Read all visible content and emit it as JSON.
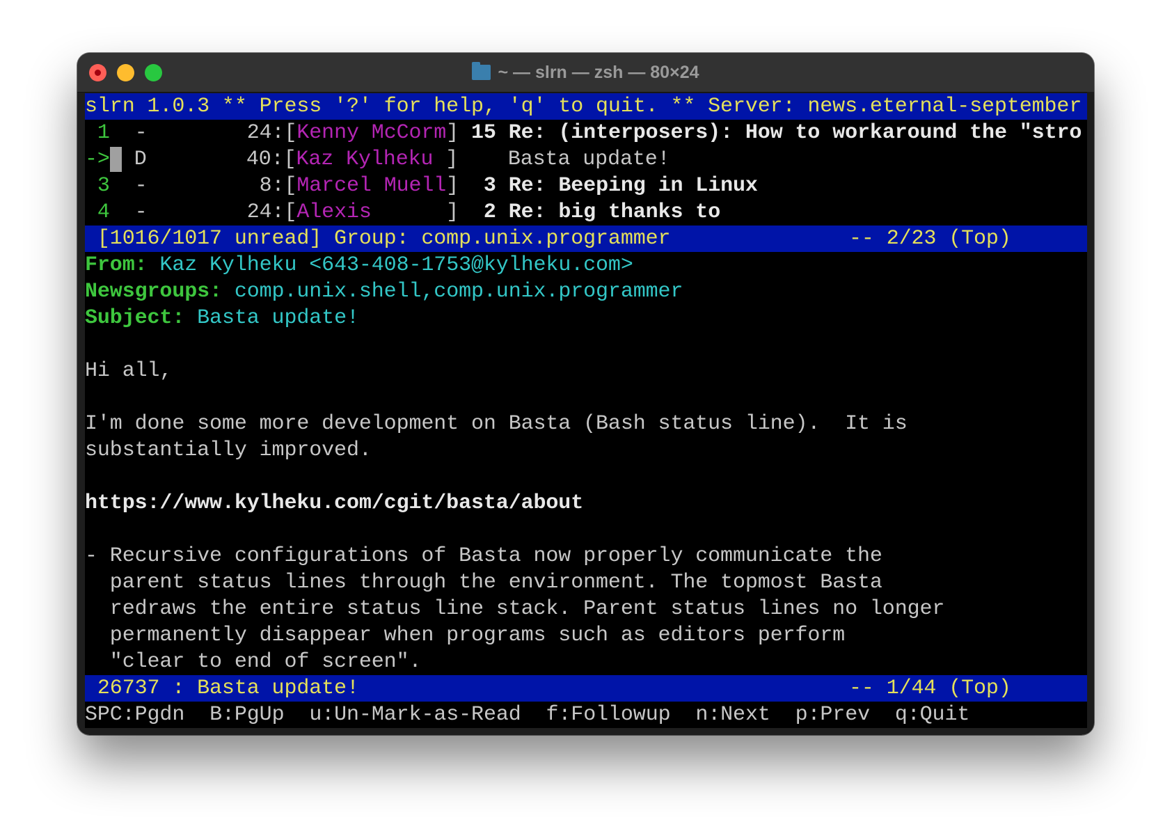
{
  "window": {
    "title": "~ — slrn — zsh — 80×24",
    "folder_icon": "folder-icon"
  },
  "top_status": "slrn 1.0.3 ** Press '?' for help, 'q' to quit. ** Server: news.eternal-september",
  "header_rows": [
    {
      "num": " 1",
      "pointer": "",
      "flag": "-",
      "lines": "        24:",
      "author": "Kenny McCorm",
      "thread_count": "15",
      "subject": "Re: (interposers): How to workaround the \"stro",
      "unread": true
    },
    {
      "num": "",
      "pointer": "->",
      "flag": "D",
      "lines": "        40:",
      "author": "Kaz Kylheku ",
      "thread_count": "  ",
      "subject": "Basta update!",
      "unread": false
    },
    {
      "num": " 3",
      "pointer": "",
      "flag": "-",
      "lines": "         8:",
      "author": "Marcel Muell",
      "thread_count": " 3",
      "subject": "Re: Beeping in Linux",
      "unread": true
    },
    {
      "num": " 4",
      "pointer": "",
      "flag": "-",
      "lines": "        24:",
      "author": "Alexis      ",
      "thread_count": " 2",
      "subject": "Re: big thanks to",
      "unread": true
    }
  ],
  "group_status": {
    "left": " [1016/1017 unread] Group: comp.unix.programmer",
    "right": "-- 2/23 (Top)"
  },
  "article_headers": [
    {
      "label": "From:",
      "value": "Kaz Kylheku <643-408-1753@kylheku.com>"
    },
    {
      "label": "Newsgroups:",
      "value": "comp.unix.shell,comp.unix.programmer"
    },
    {
      "label": "Subject:",
      "value": "Basta update!"
    }
  ],
  "body": {
    "greeting": "Hi all,",
    "para1": [
      "I'm done some more development on Basta (Bash status line).  It is",
      "substantially improved."
    ],
    "url": "https://www.kylheku.com/cgit/basta/about",
    "bullet": [
      "- Recursive configurations of Basta now properly communicate the",
      "  parent status lines through the environment. The topmost Basta",
      "  redraws the entire status line stack. Parent status lines no longer",
      "  permanently disappear when programs such as editors perform",
      "  \"clear to end of screen\"."
    ]
  },
  "article_status": {
    "left": " 26737 : Basta update!",
    "right": "-- 1/44 (Top)"
  },
  "help_line": [
    {
      "key": "SPC",
      "action": "Pgdn"
    },
    {
      "key": "B",
      "action": "PgUp"
    },
    {
      "key": "u",
      "action": "Un-Mark-as-Read"
    },
    {
      "key": "f",
      "action": "Followup"
    },
    {
      "key": "n",
      "action": "Next"
    },
    {
      "key": "p",
      "action": "Prev"
    },
    {
      "key": "q",
      "action": "Quit"
    }
  ],
  "colors": {
    "status_bar_bg": "#0014a8",
    "status_bar_fg": "#e5e05a",
    "header_label": "#3ec63e",
    "header_value": "#33c7c7",
    "author": "#b425b4"
  }
}
